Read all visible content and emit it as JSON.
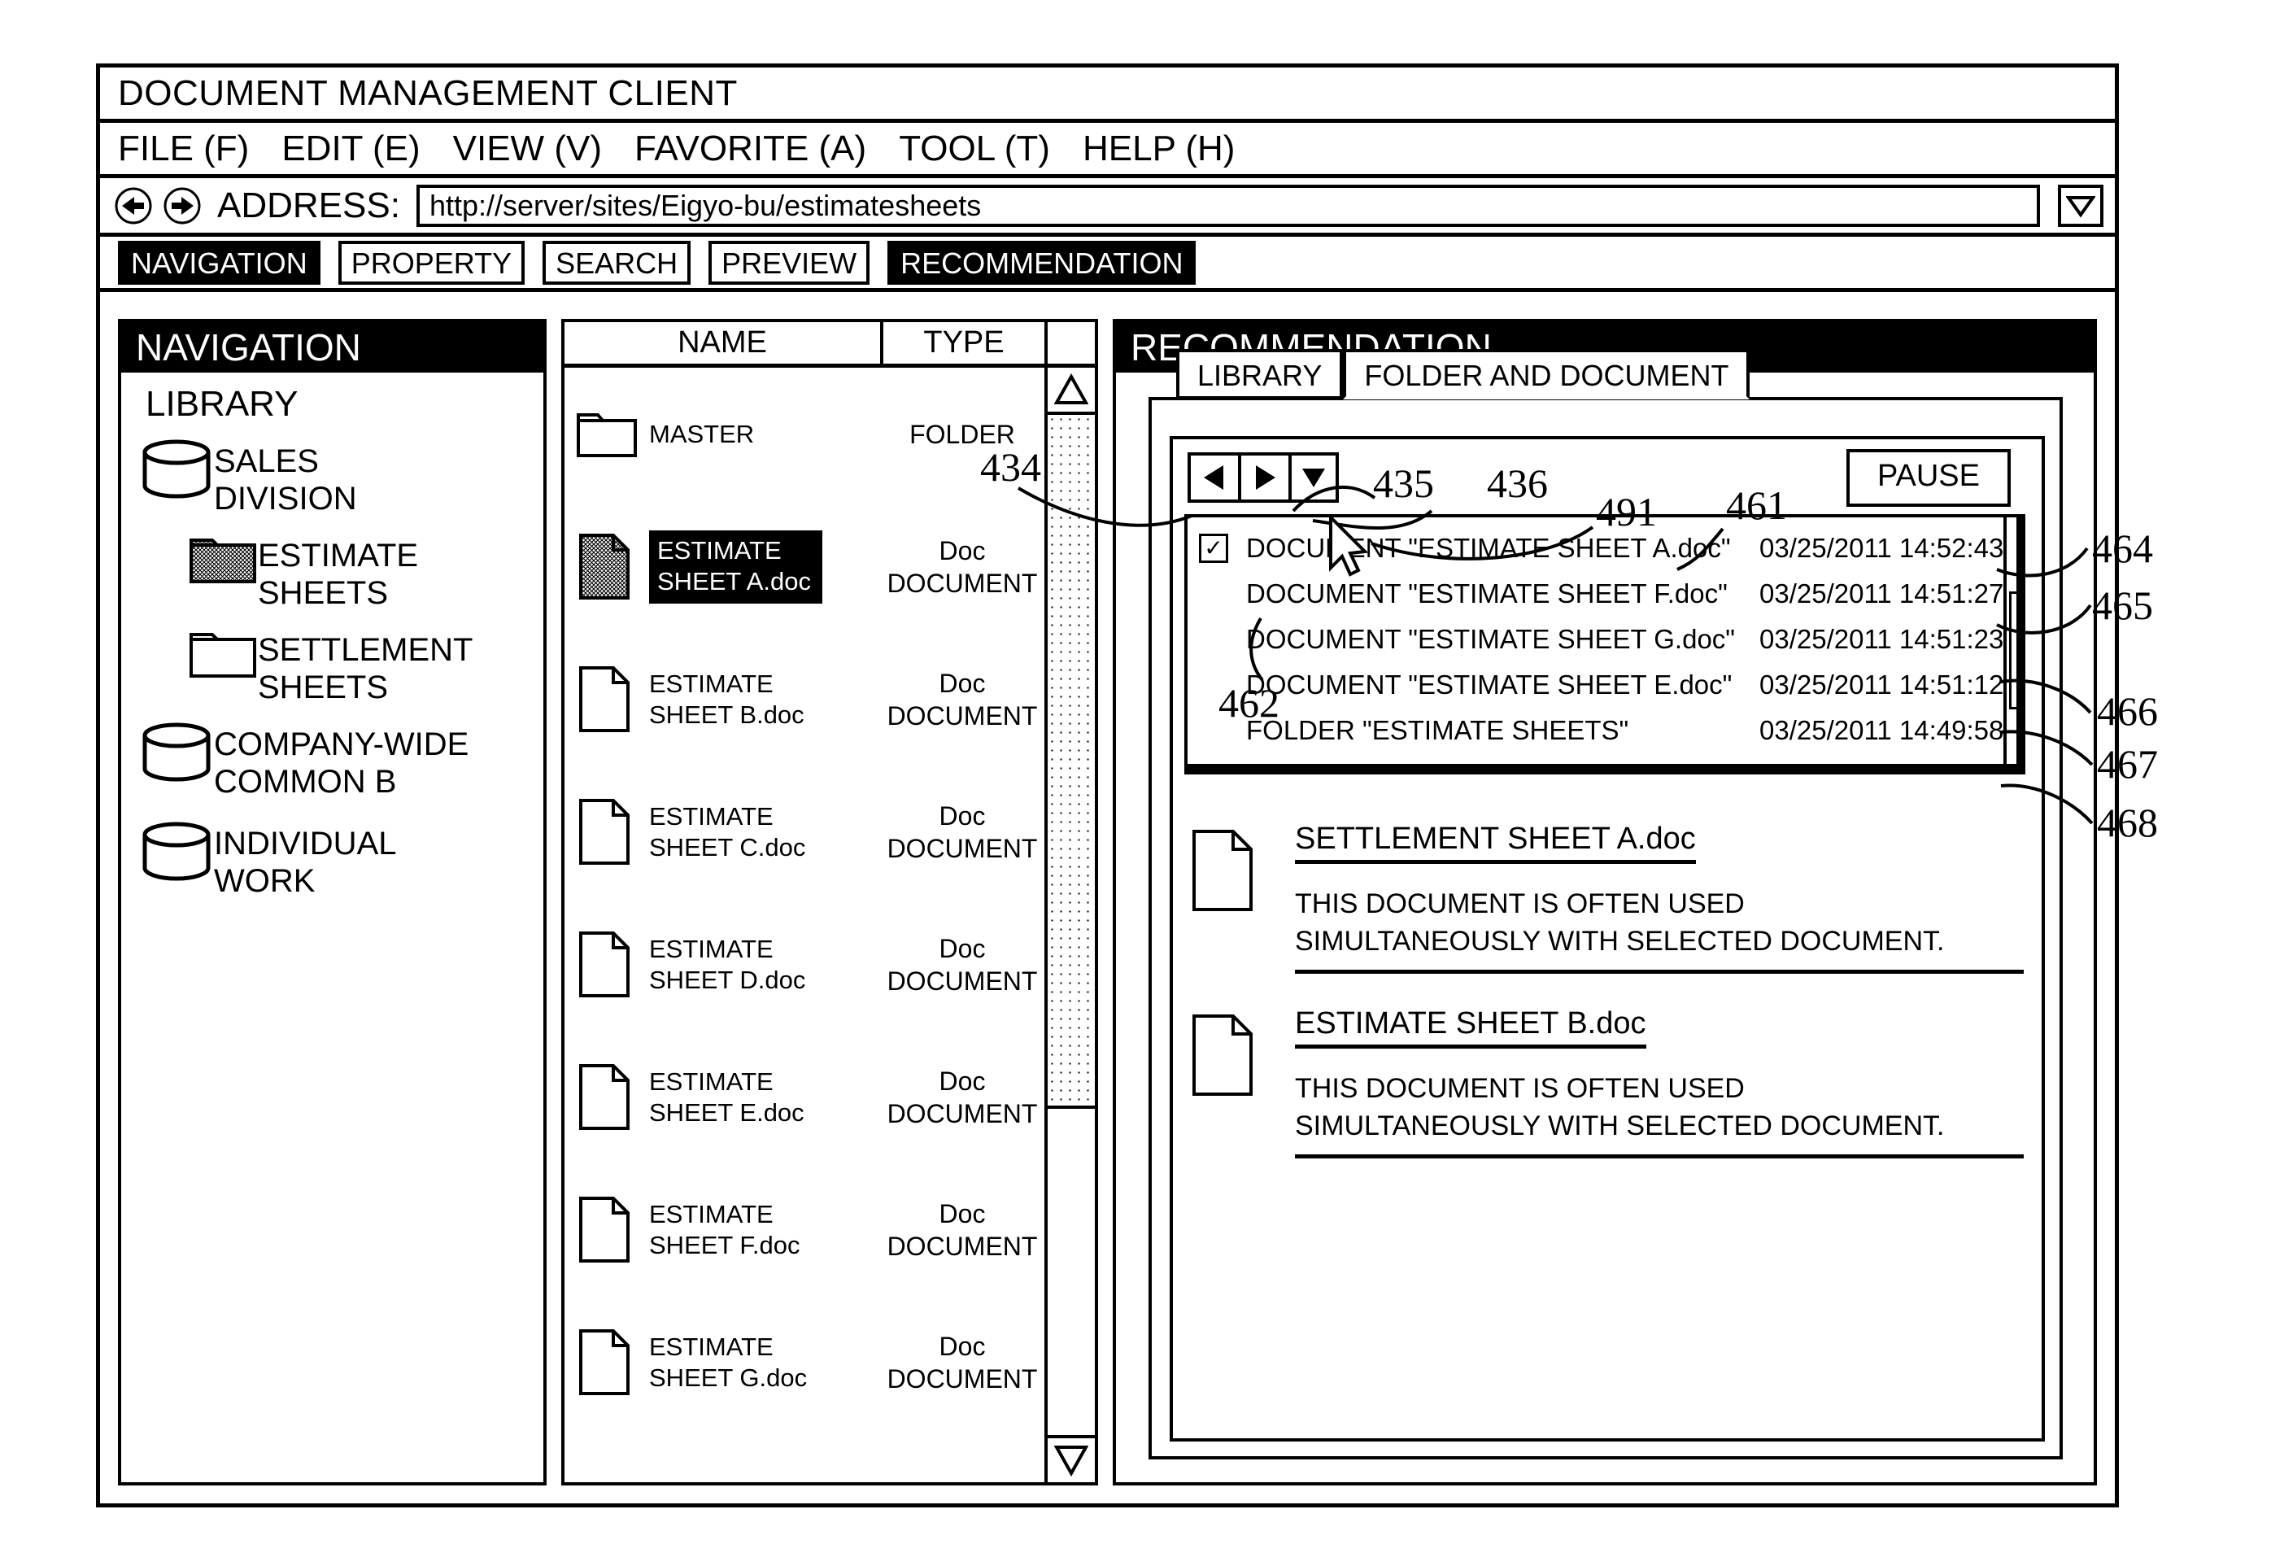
{
  "window": {
    "title": "DOCUMENT MANAGEMENT CLIENT",
    "menu": [
      "FILE (F)",
      "EDIT (E)",
      "VIEW (V)",
      "FAVORITE (A)",
      "TOOL (T)",
      "HELP (H)"
    ],
    "address": {
      "label": "ADDRESS:",
      "value": "http://server/sites/Eigyo-bu/estimatesheets",
      "back_icon": "back-arrow-icon",
      "forward_icon": "forward-arrow-icon",
      "dropdown_icon": "triangle-down-icon"
    },
    "tabs": [
      {
        "label": "NAVIGATION",
        "active": true
      },
      {
        "label": "PROPERTY",
        "active": false
      },
      {
        "label": "SEARCH",
        "active": false
      },
      {
        "label": "PREVIEW",
        "active": false
      },
      {
        "label": "RECOMMENDATION",
        "active": true
      }
    ]
  },
  "navigation": {
    "header": "NAVIGATION",
    "root": "LIBRARY",
    "items": [
      {
        "label": "SALES DIVISION",
        "icon": "database-cylinder-icon",
        "indent": 0,
        "selected": false
      },
      {
        "label": "ESTIMATE SHEETS",
        "icon": "folder-icon-filled",
        "indent": 1,
        "selected": true
      },
      {
        "label": "SETTLEMENT SHEETS",
        "icon": "folder-icon",
        "indent": 1,
        "selected": false
      },
      {
        "label": "COMPANY-WIDE COMMON B",
        "icon": "database-cylinder-icon",
        "indent": 0,
        "selected": false
      },
      {
        "label": "INDIVIDUAL WORK",
        "icon": "database-cylinder-icon",
        "indent": 0,
        "selected": false
      }
    ]
  },
  "file_list": {
    "columns": [
      "NAME",
      "TYPE"
    ],
    "rows": [
      {
        "name": "MASTER",
        "type": "FOLDER",
        "icon": "folder-icon",
        "selected": false
      },
      {
        "name": "ESTIMATE SHEET A.doc",
        "type": "Doc DOCUMENT",
        "icon": "document-icon-filled",
        "selected": true
      },
      {
        "name": "ESTIMATE SHEET B.doc",
        "type": "Doc DOCUMENT",
        "icon": "document-icon",
        "selected": false
      },
      {
        "name": "ESTIMATE SHEET C.doc",
        "type": "Doc DOCUMENT",
        "icon": "document-icon",
        "selected": false
      },
      {
        "name": "ESTIMATE SHEET D.doc",
        "type": "Doc DOCUMENT",
        "icon": "document-icon",
        "selected": false
      },
      {
        "name": "ESTIMATE SHEET E.doc",
        "type": "Doc DOCUMENT",
        "icon": "document-icon",
        "selected": false
      },
      {
        "name": "ESTIMATE SHEET F.doc",
        "type": "Doc DOCUMENT",
        "icon": "document-icon",
        "selected": false
      },
      {
        "name": "ESTIMATE SHEET G.doc",
        "type": "Doc DOCUMENT",
        "icon": "document-icon",
        "selected": false
      }
    ],
    "scroll": {
      "up_icon": "triangle-up-icon",
      "down_icon": "triangle-down-icon"
    }
  },
  "recommendation": {
    "header": "RECOMMENDATION",
    "tabs": [
      {
        "label": "LIBRARY",
        "active": false
      },
      {
        "label": "FOLDER AND DOCUMENT",
        "active": true
      }
    ],
    "toolbar": {
      "prev_icon": "triangle-left-icon",
      "next_icon": "triangle-right-icon",
      "dropdown_icon": "triangle-down-icon",
      "pause_label": "PAUSE"
    },
    "history": [
      {
        "checked": true,
        "label": "DOCUMENT \"ESTIMATE SHEET A.doc\"",
        "time": "03/25/2011 14:52:43"
      },
      {
        "checked": false,
        "label": "DOCUMENT \"ESTIMATE SHEET F.doc\"",
        "time": "03/25/2011 14:51:27"
      },
      {
        "checked": false,
        "label": "DOCUMENT \"ESTIMATE SHEET G.doc\"",
        "time": "03/25/2011 14:51:23"
      },
      {
        "checked": false,
        "label": "DOCUMENT \"ESTIMATE SHEET E.doc\"",
        "time": "03/25/2011 14:51:12"
      },
      {
        "checked": false,
        "label": "FOLDER \"ESTIMATE SHEETS\"",
        "time": "03/25/2011 14:49:58"
      }
    ],
    "cards": [
      {
        "title": "SETTLEMENT SHEET A.doc",
        "desc_line1": "THIS DOCUMENT IS OFTEN USED",
        "desc_line2": "SIMULTANEOUSLY WITH SELECTED DOCUMENT.",
        "icon": "document-icon"
      },
      {
        "title": "ESTIMATE SHEET B.doc",
        "desc_line1": "THIS DOCUMENT IS OFTEN USED",
        "desc_line2": "SIMULTANEOUSLY WITH SELECTED DOCUMENT.",
        "icon": "document-icon"
      }
    ]
  },
  "callouts": {
    "n434": "434",
    "n435": "435",
    "n436": "436",
    "n491": "491",
    "n461": "461",
    "n462": "462",
    "n464": "464",
    "n465": "465",
    "n466": "466",
    "n467": "467",
    "n468": "468"
  },
  "colors": {
    "ink": "#000000",
    "paper": "#ffffff"
  }
}
